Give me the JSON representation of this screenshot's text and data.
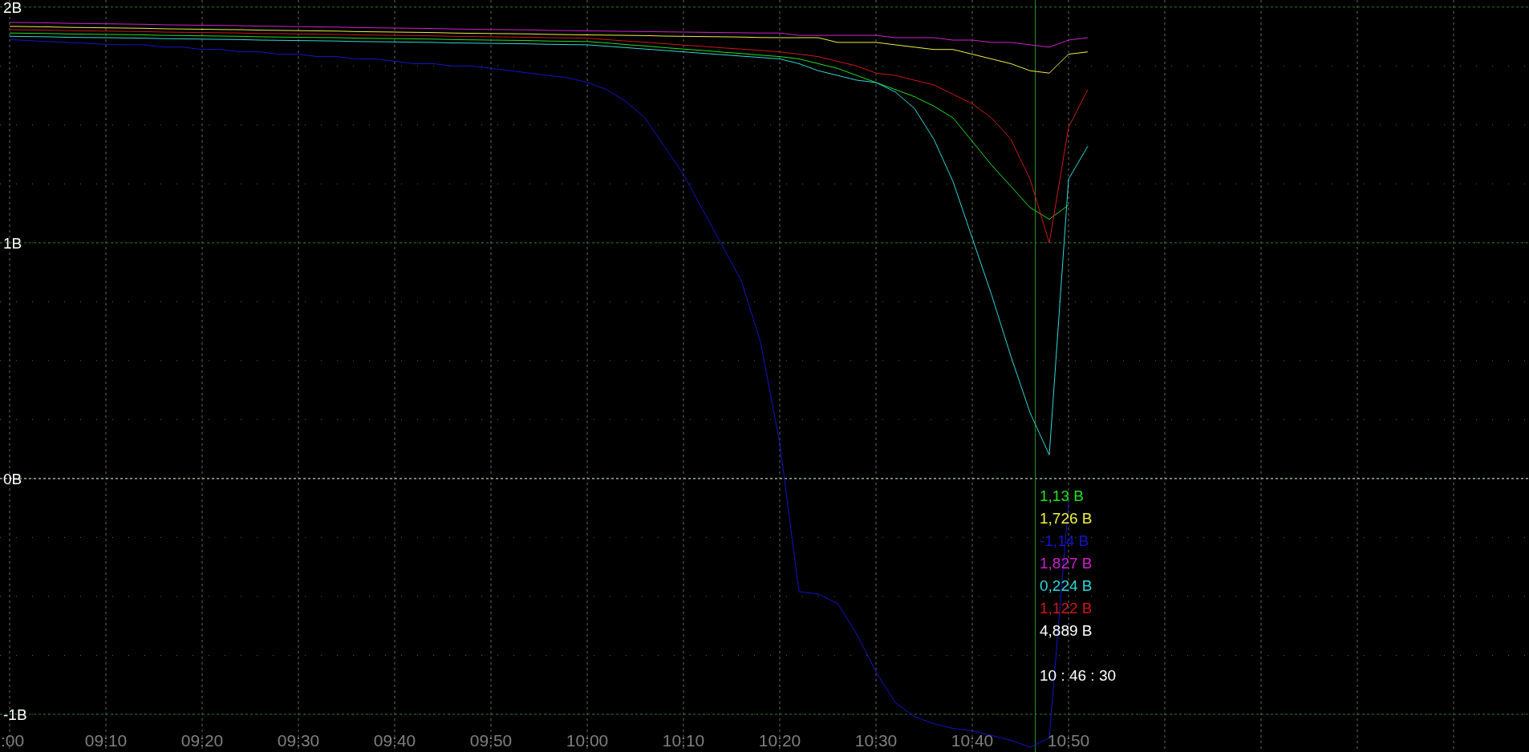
{
  "chart": {
    "chart_data": {
      "type": "line",
      "categories": [
        ":00",
        null,
        null,
        null,
        null,
        "09:10",
        null,
        null,
        null,
        null,
        "09:20",
        null,
        null,
        null,
        null,
        "09:30",
        null,
        null,
        null,
        null,
        "09:40",
        null,
        null,
        null,
        null,
        "09:50",
        null,
        null,
        null,
        null,
        "10:00",
        null,
        null,
        null,
        null,
        "10:10",
        null,
        null,
        null,
        null,
        "10:20",
        null,
        null,
        null,
        null,
        "10:30",
        null,
        null,
        null,
        null,
        "10:40",
        null,
        null,
        null,
        null,
        "10:50",
        null
      ],
      "series": [
        {
          "color": "#22e022",
          "values": [
            1.89,
            1.889,
            1.888,
            1.886,
            1.885,
            1.884,
            1.883,
            1.882,
            1.88,
            1.879,
            1.878,
            1.877,
            1.876,
            1.874,
            1.873,
            1.872,
            1.871,
            1.87,
            1.868,
            1.867,
            1.866,
            1.865,
            1.864,
            1.862,
            1.861,
            1.86,
            1.859,
            1.858,
            1.856,
            1.855,
            1.854,
            1.848,
            1.841,
            1.835,
            1.828,
            1.822,
            1.816,
            1.809,
            1.803,
            1.796,
            1.79,
            1.78,
            1.76,
            1.74,
            1.71,
            1.68,
            1.65,
            1.62,
            1.58,
            1.53,
            1.43,
            1.33,
            1.24,
            1.15,
            1.1,
            1.16,
            null
          ]
        },
        {
          "color": "#f0f040",
          "values": [
            1.918,
            1.917,
            1.916,
            1.914,
            1.913,
            1.912,
            1.911,
            1.91,
            1.908,
            1.907,
            1.906,
            1.905,
            1.904,
            1.902,
            1.901,
            1.9,
            1.899,
            1.898,
            1.896,
            1.895,
            1.894,
            1.893,
            1.892,
            1.89,
            1.889,
            1.888,
            1.887,
            1.886,
            1.884,
            1.883,
            1.882,
            1.881,
            1.88,
            1.879,
            1.877,
            1.876,
            1.875,
            1.874,
            1.873,
            1.871,
            1.87,
            1.87,
            1.87,
            1.85,
            1.85,
            1.85,
            1.84,
            1.83,
            1.82,
            1.82,
            1.8,
            1.78,
            1.76,
            1.73,
            1.72,
            1.8,
            1.81
          ]
        },
        {
          "color": "#1414c8",
          "values": [
            1.862,
            1.858,
            1.854,
            1.85,
            1.846,
            1.842,
            1.84,
            1.84,
            1.83,
            1.83,
            1.82,
            1.82,
            1.81,
            1.81,
            1.8,
            1.8,
            1.79,
            1.79,
            1.78,
            1.78,
            1.77,
            1.76,
            1.76,
            1.75,
            1.75,
            1.74,
            1.73,
            1.72,
            1.71,
            1.7,
            1.68,
            1.65,
            1.6,
            1.53,
            1.41,
            1.29,
            1.14,
            0.99,
            0.84,
            0.58,
            0.15,
            -0.48,
            -0.49,
            -0.53,
            -0.66,
            -0.82,
            -0.95,
            -1.01,
            -1.04,
            -1.06,
            -1.07,
            -1.09,
            -1.11,
            -1.14,
            -1.1,
            -0.1,
            null
          ]
        },
        {
          "color": "#d020d0",
          "values": [
            1.935,
            1.934,
            1.933,
            1.931,
            1.93,
            1.929,
            1.928,
            1.927,
            1.925,
            1.924,
            1.923,
            1.922,
            1.921,
            1.919,
            1.918,
            1.917,
            1.916,
            1.915,
            1.913,
            1.912,
            1.911,
            1.91,
            1.909,
            1.907,
            1.906,
            1.905,
            1.904,
            1.903,
            1.901,
            1.9,
            1.899,
            1.898,
            1.897,
            1.896,
            1.895,
            1.894,
            1.893,
            1.892,
            1.891,
            1.89,
            1.89,
            1.88,
            1.88,
            1.88,
            1.88,
            1.88,
            1.87,
            1.87,
            1.87,
            1.86,
            1.86,
            1.85,
            1.85,
            1.84,
            1.83,
            1.86,
            1.87
          ]
        },
        {
          "color": "#30d8d8",
          "values": [
            1.876,
            1.875,
            1.874,
            1.872,
            1.871,
            1.87,
            1.869,
            1.868,
            1.866,
            1.865,
            1.864,
            1.863,
            1.862,
            1.86,
            1.859,
            1.858,
            1.857,
            1.856,
            1.854,
            1.853,
            1.852,
            1.851,
            1.85,
            1.848,
            1.847,
            1.846,
            1.845,
            1.844,
            1.842,
            1.841,
            1.84,
            1.834,
            1.828,
            1.822,
            1.816,
            1.81,
            1.804,
            1.798,
            1.792,
            1.786,
            1.78,
            1.76,
            1.73,
            1.71,
            1.69,
            1.68,
            1.64,
            1.57,
            1.44,
            1.26,
            1.02,
            0.78,
            0.52,
            0.28,
            0.1,
            1.27,
            1.41
          ]
        },
        {
          "color": "#d01818",
          "values": [
            1.904,
            1.903,
            1.902,
            1.9,
            1.899,
            1.898,
            1.897,
            1.896,
            1.894,
            1.893,
            1.892,
            1.891,
            1.89,
            1.888,
            1.887,
            1.886,
            1.885,
            1.884,
            1.882,
            1.881,
            1.88,
            1.879,
            1.878,
            1.876,
            1.875,
            1.874,
            1.873,
            1.872,
            1.87,
            1.869,
            1.868,
            1.862,
            1.856,
            1.851,
            1.845,
            1.839,
            1.833,
            1.827,
            1.822,
            1.816,
            1.81,
            1.8,
            1.79,
            1.77,
            1.75,
            1.72,
            1.71,
            1.69,
            1.67,
            1.63,
            1.59,
            1.53,
            1.44,
            1.27,
            1.0,
            1.49,
            1.65
          ]
        }
      ],
      "ylim": [
        -1.16,
        2.03
      ],
      "yticks": [
        {
          "value": 2,
          "label": "2B"
        },
        {
          "value": 1,
          "label": "1B"
        },
        {
          "value": 0,
          "label": "0B"
        },
        {
          "value": -1,
          "label": "-1B"
        }
      ],
      "grid": true,
      "ref_lines": [
        {
          "axis": "y",
          "value": 0
        }
      ],
      "annotations": [
        "10 : 46 : 30"
      ]
    },
    "cursor": {
      "level": 0.6768
    },
    "cursor_readout": {
      "values": [
        {
          "text": "1,13 B",
          "color": "#22e022"
        },
        {
          "text": "1,726 B",
          "color": "#f0f040"
        },
        {
          "text": "-1,14 B",
          "color": "#1414c8"
        },
        {
          "text": "1,827 B",
          "color": "#d020d0"
        },
        {
          "text": "0,224 B",
          "color": "#30d8d8"
        },
        {
          "text": "1,122 B",
          "color": "#d01818"
        },
        {
          "text": "4,889 B",
          "color": "#ffffff"
        }
      ]
    }
  }
}
